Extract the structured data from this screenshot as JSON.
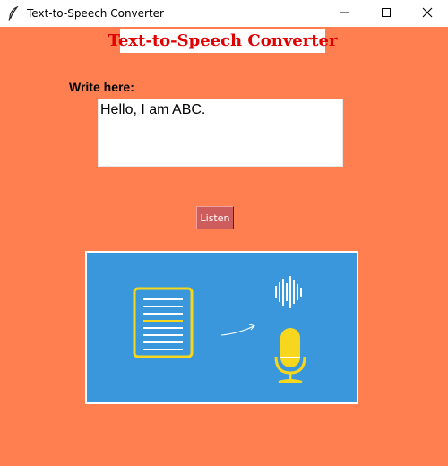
{
  "window": {
    "title": "Text-to-Speech Converter",
    "icons": {
      "app": "feather-icon",
      "minimize": "minimize-icon",
      "maximize": "maximize-icon",
      "close": "close-icon"
    }
  },
  "main": {
    "heading": "Text-to-Speech Converter",
    "input_label": "Write here:",
    "input_value": "Hello, I am ABC.",
    "listen_label": "Listen"
  },
  "illustration": {
    "icons": [
      "document-icon",
      "arrow-icon",
      "sound-wave-icon",
      "microphone-icon"
    ]
  },
  "colors": {
    "background": "#ff7f50",
    "heading_text": "#e00000",
    "button": "#cd5c5c",
    "illustration_bg": "#3a97db",
    "accent_yellow": "#f7d71e"
  }
}
